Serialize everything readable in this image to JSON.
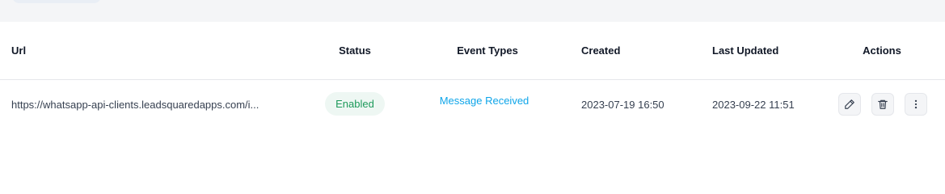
{
  "table": {
    "headers": {
      "url": "Url",
      "status": "Status",
      "event_types": "Event Types",
      "created": "Created",
      "last_updated": "Last Updated",
      "actions": "Actions"
    },
    "rows": [
      {
        "url": "https://whatsapp-api-clients.leadsquaredapps.com/i...",
        "status": "Enabled",
        "event_type": "Message Received",
        "created": "2023-07-19 16:50",
        "last_updated": "2023-09-22 11:51",
        "actions": [
          "edit-icon",
          "trash-icon",
          "more-vertical-icon"
        ]
      }
    ]
  },
  "colors": {
    "status_enabled_text": "#1d9a5b",
    "status_enabled_bg": "#eef7f3",
    "event_link": "#0ea5e9"
  }
}
